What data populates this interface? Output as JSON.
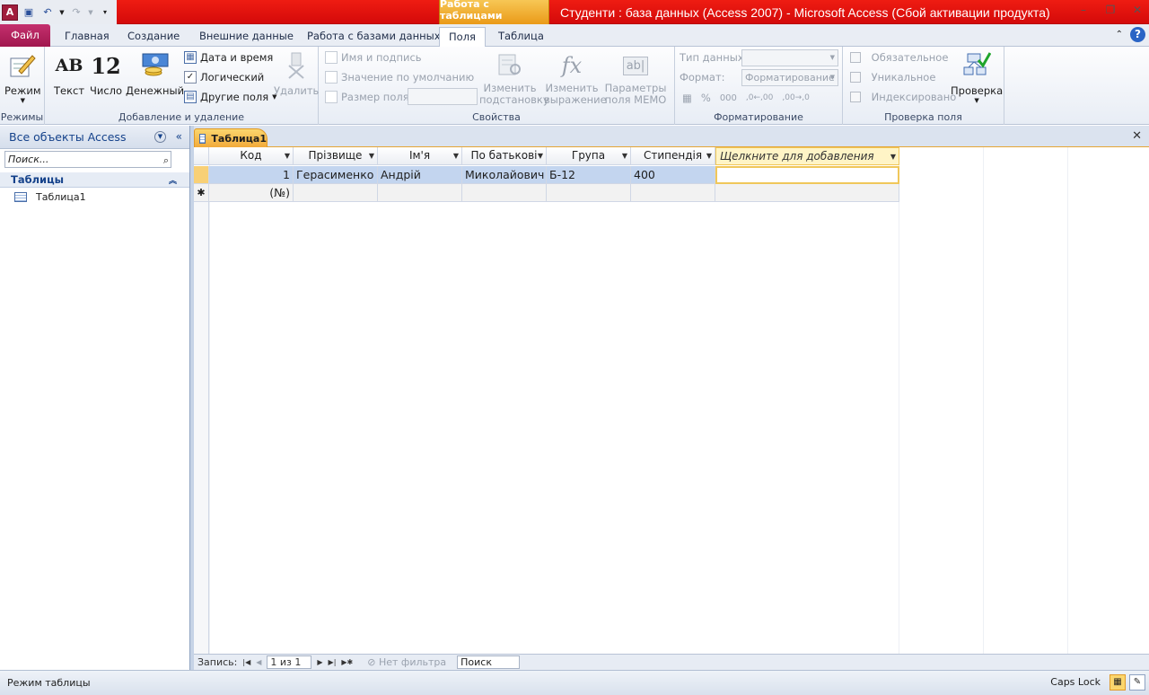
{
  "window": {
    "title": "Студенти : база данных (Access 2007)  -  Microsoft Access (Сбой активации продукта)",
    "context_group": "Работа с таблицами"
  },
  "tabs": [
    {
      "label": "Файл"
    },
    {
      "label": "Главная"
    },
    {
      "label": "Создание"
    },
    {
      "label": "Внешние данные"
    },
    {
      "label": "Работа с базами данных"
    },
    {
      "label": "Поля"
    },
    {
      "label": "Таблица"
    }
  ],
  "ribbon": {
    "modes": {
      "label": "Режимы",
      "view": "Режим"
    },
    "addremove": {
      "label": "Добавление и удаление",
      "text": "Текст",
      "number": "Число",
      "currency": "Денежный",
      "datetime": "Дата и время",
      "logical": "Логический",
      "other": "Другие поля",
      "delete": "Удалить",
      "ab_glyph": "AB",
      "num_glyph": "12"
    },
    "props": {
      "label": "Свойства",
      "name_caption": "Имя и подпись",
      "default_value": "Значение по умолчанию",
      "field_size": "Размер поля",
      "modify_lookup": "Изменить подстановку",
      "modify_expr": "Изменить выражение",
      "memo": "Параметры поля MEMO",
      "fx_glyph": "fx",
      "ab_box": "ab|"
    },
    "format": {
      "label": "Форматирование",
      "data_type": "Тип данных:",
      "format": "Формат:",
      "format_value": "Форматирование",
      "pct": "%",
      "thousands": "000",
      "inc_dec": ",0←,00",
      "dec_dec": ",00→,0"
    },
    "validation": {
      "label": "Проверка поля",
      "required": "Обязательное",
      "unique": "Уникальное",
      "indexed": "Индексировано",
      "check": "Проверка"
    }
  },
  "nav": {
    "title": "Все объекты Access",
    "search_placeholder": "Поиск...",
    "group": "Таблицы",
    "items": [
      {
        "label": "Таблица1"
      }
    ]
  },
  "document": {
    "tab": "Таблица1"
  },
  "table": {
    "headers": [
      "Код",
      "Прізвище",
      "Ім'я",
      "По батькові",
      "Група",
      "Стипендія"
    ],
    "add_header": "Щелкните для добавления",
    "rows": [
      [
        "1",
        "Герасименко",
        "Андрій",
        "Миколайович",
        "Б-12",
        "400"
      ]
    ],
    "new_row": "(№)",
    "new_marker": "✱"
  },
  "recbar": {
    "label": "Запись:",
    "position": "1 из 1",
    "filter": "Нет фильтра",
    "search": "Поиск"
  },
  "status": {
    "mode": "Режим таблицы",
    "caps": "Caps Lock"
  }
}
